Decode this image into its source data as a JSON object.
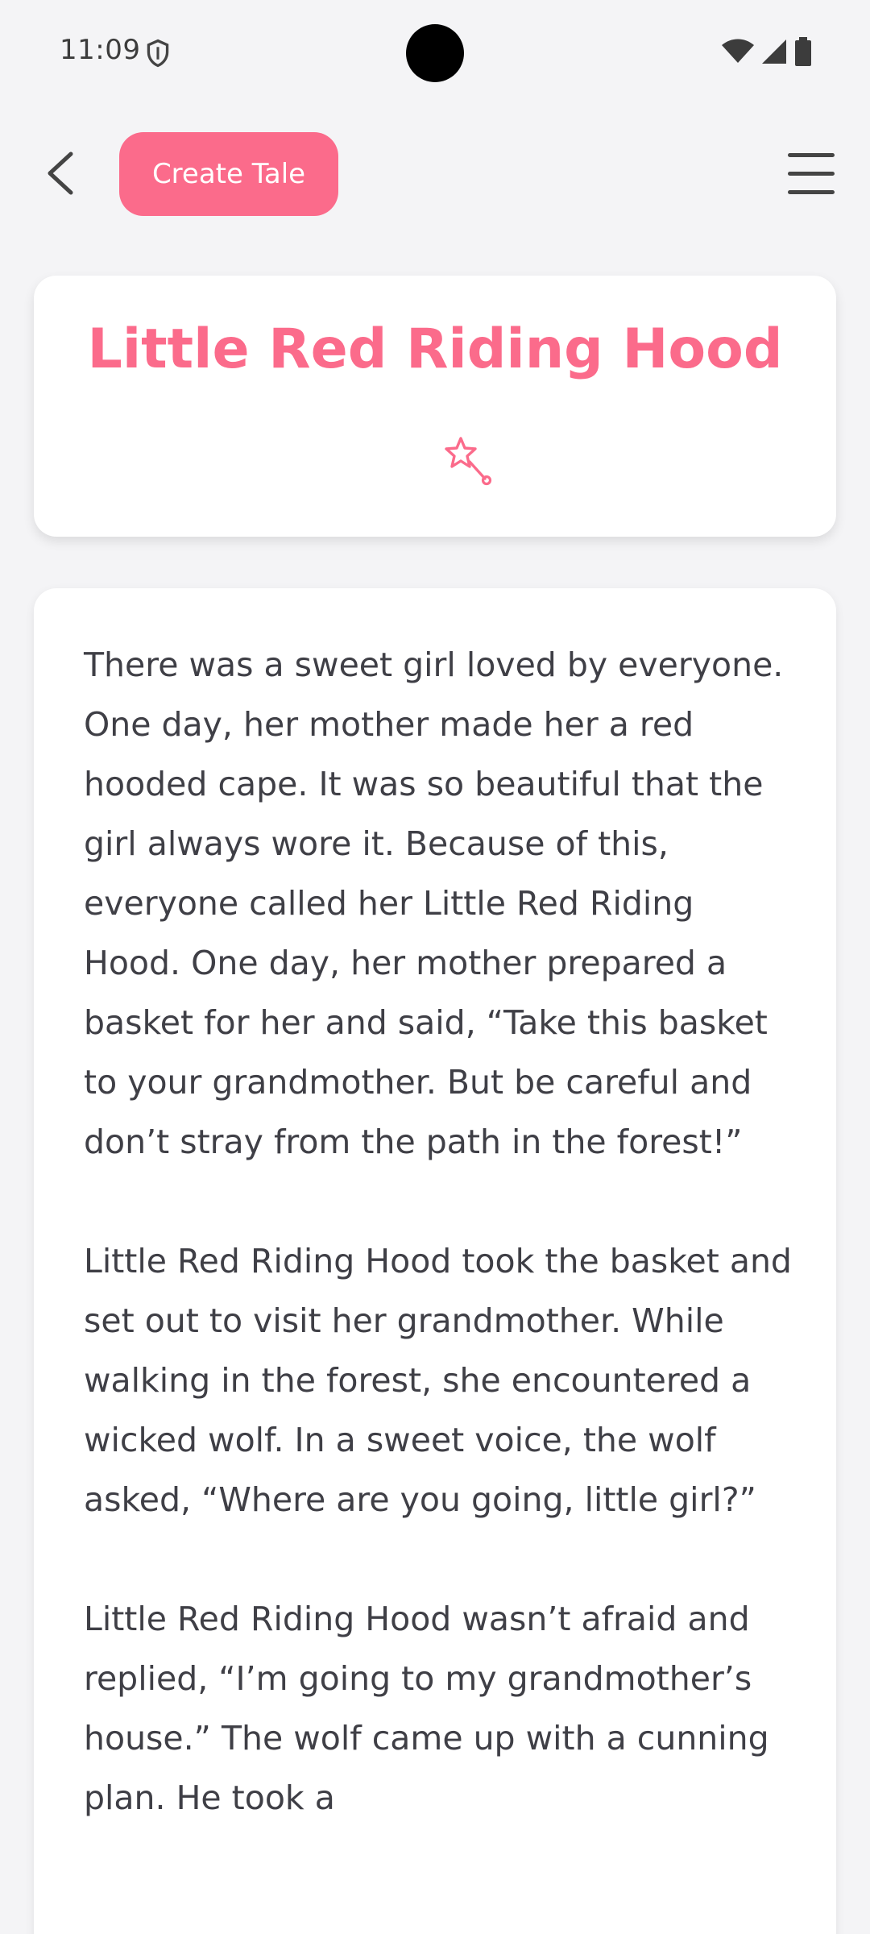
{
  "status_bar": {
    "time": "11:09",
    "icons": [
      "shield-icon",
      "wifi-icon",
      "signal-icon",
      "battery-icon"
    ]
  },
  "header": {
    "back_icon": "chevron-left-icon",
    "create_label": "Create Tale",
    "menu_icon": "hamburger-menu-icon"
  },
  "story": {
    "title": "Little Red Riding Hood",
    "title_icon": "magic-wand-icon",
    "paragraphs": [
      "There was a sweet girl loved by everyone. One day, her mother made her a red hooded cape. It was so beautiful that the girl always wore it. Because of this, everyone called her Little Red Riding Hood. One day, her mother prepared a basket for her and said, “Take this basket to your grandmother. But be careful and don’t stray from the path in the forest!”",
      "Little Red Riding Hood took the basket and set out to visit her grandmother. While walking in the forest, she encountered a wicked wolf. In a sweet voice, the wolf asked, “Where are you going, little girl?”",
      "Little Red Riding Hood wasn’t afraid and replied, “I’m going to my grandmother’s house.” The wolf came up with a cunning plan. He took a"
    ]
  },
  "colors": {
    "accent": "#fb6b8b",
    "background": "#f4f4f6",
    "card": "#ffffff",
    "text": "#3f3f46"
  }
}
